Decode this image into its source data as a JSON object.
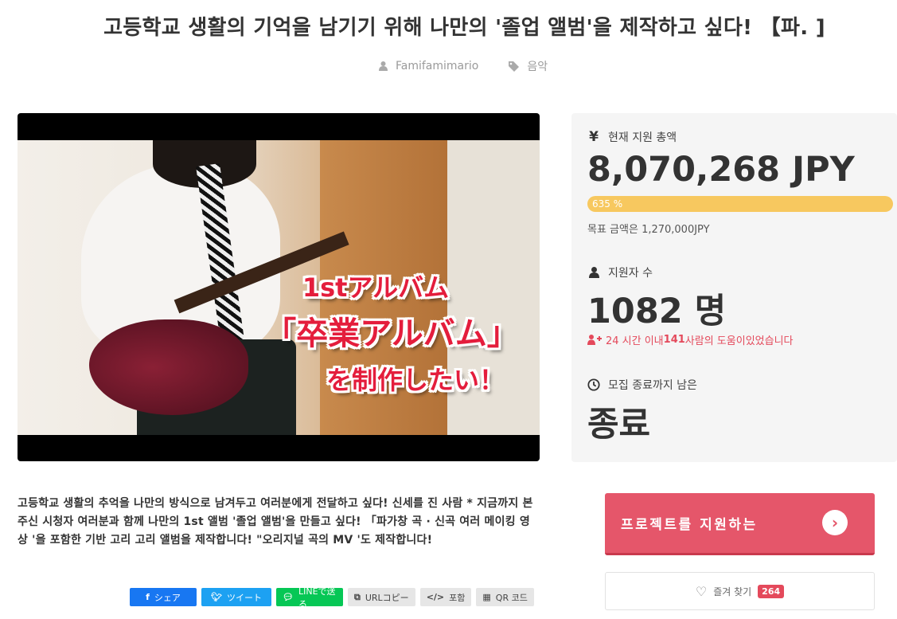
{
  "project": {
    "title": "고등학교 생활의 기억을 남기기 위해 나만의 '졸업 앨범'을 제작하고 싶다! 【파. ]",
    "author": "Famifamimario",
    "category": "음악"
  },
  "video": {
    "overlay_line1": "1stアルバム",
    "overlay_line2": "「卒業アルバム」",
    "overlay_line3": "を制作したい！"
  },
  "stats": {
    "total_label": "현재 지원 총액",
    "total_icon": "yen-icon",
    "total_value": "8,070,268 JPY",
    "progress_label": "635 %",
    "progress_fraction": 1.0,
    "goal_text": "목표 금액은 1,270,000JPY",
    "backers_label": "지원자 수",
    "backers_value": "1082 명",
    "recent_prefix": "24 시간 이내",
    "recent_count": "141",
    "recent_suffix": "사람의 도움이있었습니다",
    "remaining_label": "모집 종료까지 남은",
    "remaining_value": "종료"
  },
  "description": "고등학교 생활의 추억을 나만의 방식으로 남겨두고 여러분에게 전달하고 싶다! 신세를 진 사람 * 지금까지 본 주신 시청자 여러분과 함께 나만의 1st 앨범 '졸업 앨범'을 만들고 싶다! 「파가창 곡 · 신곡 여러 메이킹 영상 '을 포함한 기반 고리 고리 앨범을 제작합니다! \"오리지널 곡의 MV '도 제작합니다!",
  "share": {
    "facebook": "シェア",
    "twitter": "ツイート",
    "line": "LINEで送る",
    "url": "URLコピー",
    "embed": "포함",
    "qr": "QR 코드"
  },
  "actions": {
    "support_label": "프로젝트를 지원하는",
    "favorite_label": "즐겨 찾기",
    "favorite_count": "264"
  },
  "colors": {
    "accent": "#e5566a",
    "progress": "#f7c85f",
    "facebook": "#1877f2",
    "twitter": "#1da1f2",
    "line": "#06c755"
  }
}
